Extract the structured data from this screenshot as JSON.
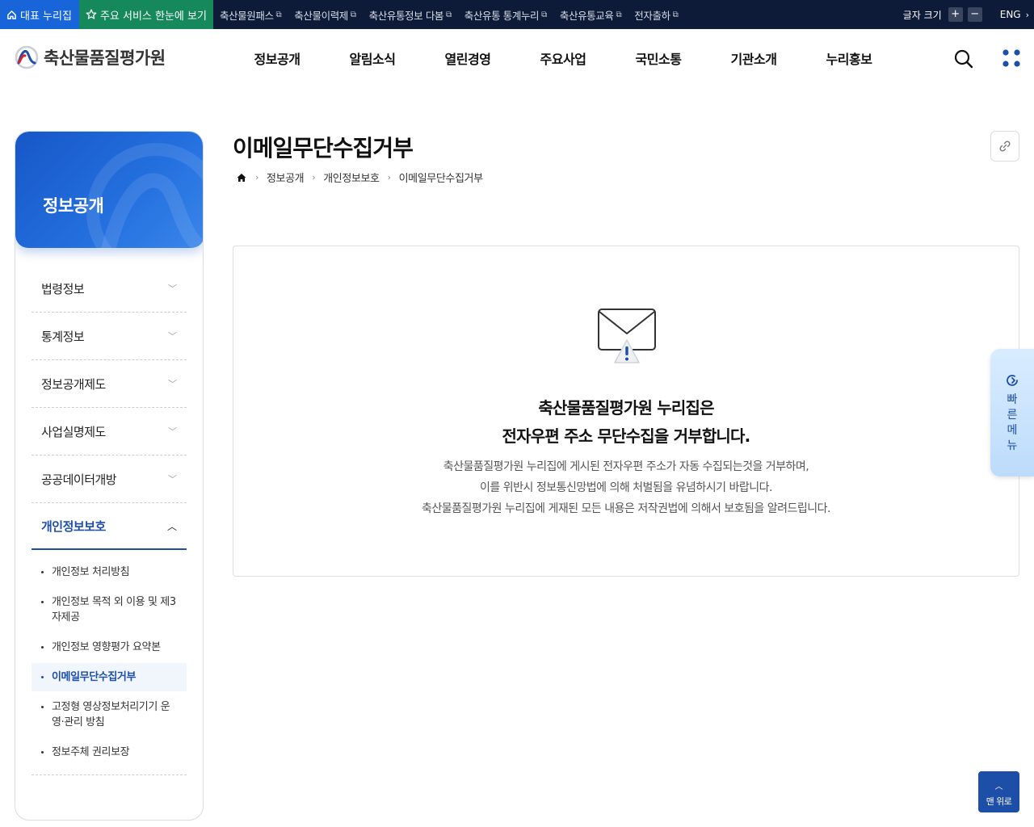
{
  "topbar": {
    "home_label": "대표 누리집",
    "all_services_label": "주요 서비스 한눈에 보기",
    "links": [
      "축산물원패스",
      "축산물이력제",
      "축산유통정보 다봄",
      "축산유통 통계누리",
      "축산유통교육",
      "전자출하"
    ],
    "font_size_label": "글자 크기",
    "font_plus": "+",
    "font_minus": "−",
    "lang_label": "ENG"
  },
  "header": {
    "logo_text": "축산물품질평가원",
    "gnb": [
      "정보공개",
      "알림소식",
      "열린경영",
      "주요사업",
      "국민소통",
      "기관소개",
      "누리홍보"
    ]
  },
  "lnb": {
    "hero_title": "정보공개",
    "items": [
      "법령정보",
      "통계정보",
      "정보공개제도",
      "사업실명제도",
      "공공데이터개방",
      "개인정보보호"
    ],
    "sub_items": [
      "개인정보 처리방침",
      "개인정보 목적 외 이용 및 제3자제공",
      "개인정보 영향평가 요약본",
      "이메일무단수집거부",
      "고정형 영상정보처리기기 운영·관리 방침",
      "정보주체 권리보장"
    ]
  },
  "content": {
    "title": "이메일무단수집거부",
    "breadcrumb": [
      "정보공개",
      "개인정보보호",
      "이메일무단수집거부"
    ],
    "notice_heading_1": "축산물품질평가원 누리집은",
    "notice_heading_2": "전자우편 주소 무단수집을 거부합니다.",
    "notice_lines": [
      "축산물품질평가원 누리집에 게시된 전자우편 주소가 자동 수집되는것을 거부하며,",
      "이를 위반시 정보통신망법에 의해 처벌됨을 유념하시기 바랍니다.",
      "축산물품질평가원 누리집에 게재된 모든 내용은 저작권법에 의해서 보호됨을 알려드립니다."
    ]
  },
  "quick_menu": {
    "label": "빠른메뉴"
  },
  "top_button": {
    "label": "맨 위로"
  },
  "colors": {
    "primary": "#1d4ea8",
    "topbar_bg": "#0d1a38",
    "home_bg": "#1765d8",
    "all_services_bg": "#16895c"
  }
}
